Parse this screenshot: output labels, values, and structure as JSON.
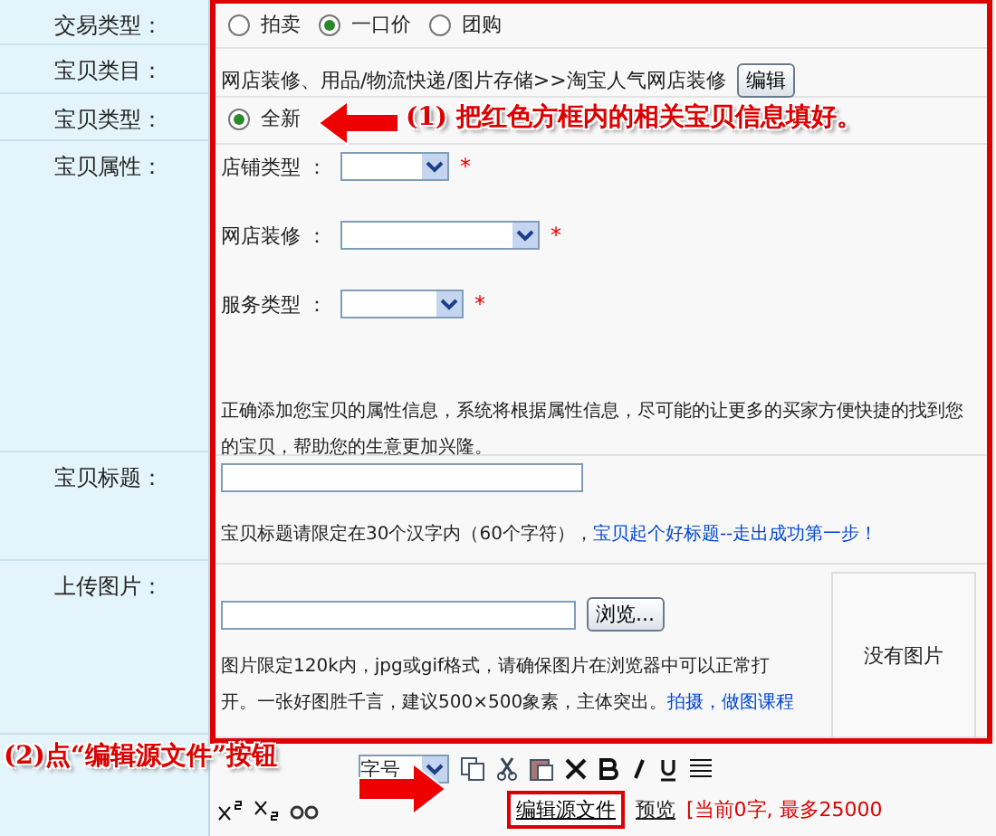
{
  "rows": [
    {
      "label": "交易类型：",
      "kind": "radios",
      "options": [
        {
          "label": "拍卖",
          "selected": false
        },
        {
          "label": "一口价",
          "selected": true
        },
        {
          "label": "团购",
          "selected": false
        }
      ]
    },
    {
      "label": "宝贝类目：",
      "kind": "category",
      "text": "网店装修、用品/物流快递/图片存储>>淘宝人气网店装修",
      "button": "编辑"
    },
    {
      "label": "宝贝类型：",
      "kind": "radios",
      "options": [
        {
          "label": "全新",
          "selected": true
        }
      ]
    },
    {
      "label": "宝贝属性：",
      "kind": "attributes",
      "fields": [
        {
          "label": "店铺类型 ：",
          "required": "*"
        },
        {
          "label": "网店装修 ：",
          "required": "*"
        },
        {
          "label": "服务类型 ：",
          "required": "*"
        }
      ],
      "note": "正确添加您宝贝的属性信息，系统将根据属性信息，尽可能的让更多的买家方便快捷的找到您的宝贝，帮助您的生意更加兴隆。"
    },
    {
      "label": "宝贝标题：",
      "kind": "title",
      "note": "宝贝标题请限定在30个汉字内（60个字符），",
      "link": "宝贝起个好标题--走出成功第一步！"
    },
    {
      "label": "上传图片：",
      "kind": "upload",
      "button": "浏览...",
      "note": "图片限定120k内，jpg或gif格式，请确保图片在浏览器中可以正常打开。一张好图胜千言，建议500×500象素，主体突出。",
      "link": "拍摄，做图课程",
      "preview": "没有图片"
    }
  ],
  "editor": {
    "font_size": "字号",
    "source_button": "编辑源文件",
    "preview_link": "预览",
    "counter": "[当前0字, 最多25000"
  },
  "annotations": [
    {
      "text": "(1) 把红色方框内的相关宝贝信息填好。"
    },
    {
      "text": "(2)点“编辑源文件”按钮"
    }
  ]
}
